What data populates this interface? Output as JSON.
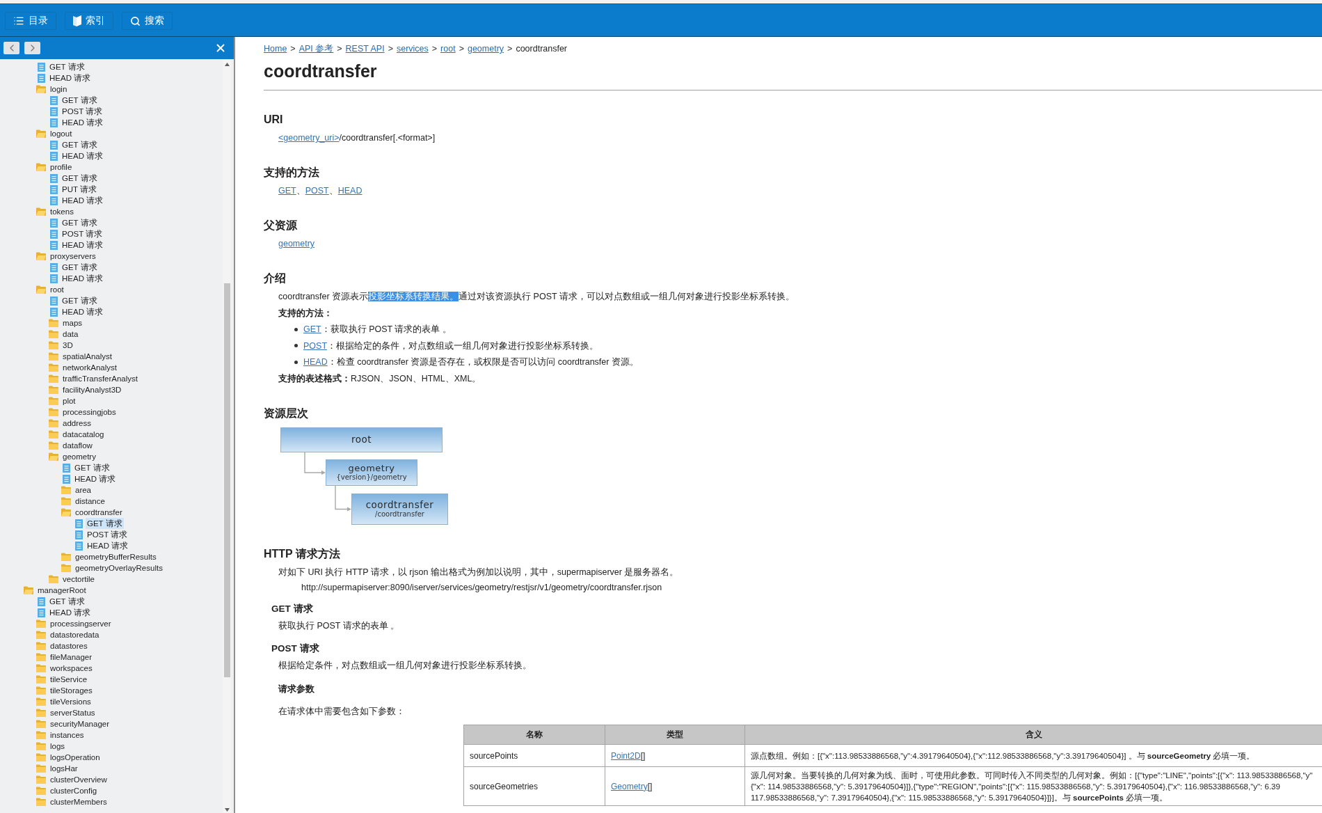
{
  "toolbar": {
    "buttons": [
      {
        "kind": "contents",
        "label": "目录"
      },
      {
        "kind": "index",
        "label": "索引"
      },
      {
        "kind": "search",
        "label": "搜索"
      }
    ]
  },
  "sidebar": {
    "tree": [
      {
        "children": [
          {
            "kind": "file",
            "label": "GET 请求",
            "selected": false
          },
          {
            "kind": "file",
            "label": "HEAD 请求",
            "selected": false
          },
          {
            "kind": "folder",
            "label": "login",
            "expanded": true,
            "selected": false,
            "children": [
              {
                "kind": "file",
                "label": "GET 请求",
                "selected": false
              },
              {
                "kind": "file",
                "label": "POST 请求",
                "selected": false
              },
              {
                "kind": "file",
                "label": "HEAD 请求",
                "selected": false
              }
            ]
          },
          {
            "kind": "folder",
            "label": "logout",
            "expanded": true,
            "selected": false,
            "children": [
              {
                "kind": "file",
                "label": "GET 请求",
                "selected": false
              },
              {
                "kind": "file",
                "label": "HEAD 请求",
                "selected": false
              }
            ]
          },
          {
            "kind": "folder",
            "label": "profile",
            "expanded": true,
            "selected": false,
            "children": [
              {
                "kind": "file",
                "label": "GET 请求",
                "selected": false
              },
              {
                "kind": "file",
                "label": "PUT 请求",
                "selected": false
              },
              {
                "kind": "file",
                "label": "HEAD 请求",
                "selected": false
              }
            ]
          },
          {
            "kind": "folder",
            "label": "tokens",
            "expanded": true,
            "selected": false,
            "children": [
              {
                "kind": "file",
                "label": "GET 请求",
                "selected": false
              },
              {
                "kind": "file",
                "label": "POST 请求",
                "selected": false
              },
              {
                "kind": "file",
                "label": "HEAD 请求",
                "selected": false
              }
            ]
          },
          {
            "kind": "folder",
            "label": "proxyservers",
            "expanded": true,
            "selected": false,
            "children": [
              {
                "kind": "file",
                "label": "GET 请求",
                "selected": false
              },
              {
                "kind": "file",
                "label": "HEAD 请求",
                "selected": false
              }
            ]
          },
          {
            "kind": "folder",
            "label": "root",
            "expanded": true,
            "selected": false,
            "children": [
              {
                "kind": "file",
                "label": "GET 请求",
                "selected": false
              },
              {
                "kind": "file",
                "label": "HEAD 请求",
                "selected": false
              },
              {
                "kind": "folder",
                "label": "maps",
                "expanded": false,
                "selected": false
              },
              {
                "kind": "folder",
                "label": "data",
                "expanded": false,
                "selected": false
              },
              {
                "kind": "folder",
                "label": "3D",
                "expanded": false,
                "selected": false
              },
              {
                "kind": "folder",
                "label": "spatialAnalyst",
                "expanded": false,
                "selected": false
              },
              {
                "kind": "folder",
                "label": "networkAnalyst",
                "expanded": false,
                "selected": false
              },
              {
                "kind": "folder",
                "label": "trafficTransferAnalyst",
                "expanded": false,
                "selected": false
              },
              {
                "kind": "folder",
                "label": "facilityAnalyst3D",
                "expanded": false,
                "selected": false
              },
              {
                "kind": "folder",
                "label": "plot",
                "expanded": false,
                "selected": false
              },
              {
                "kind": "folder",
                "label": "processingjobs",
                "expanded": false,
                "selected": false
              },
              {
                "kind": "folder",
                "label": "address",
                "expanded": false,
                "selected": false
              },
              {
                "kind": "folder",
                "label": "datacatalog",
                "expanded": false,
                "selected": false
              },
              {
                "kind": "folder",
                "label": "dataflow",
                "expanded": false,
                "selected": false
              },
              {
                "kind": "folder",
                "label": "geometry",
                "expanded": true,
                "selected": false,
                "children": [
                  {
                    "kind": "file",
                    "label": "GET 请求",
                    "selected": false
                  },
                  {
                    "kind": "file",
                    "label": "HEAD 请求",
                    "selected": false
                  },
                  {
                    "kind": "folder",
                    "label": "area",
                    "expanded": false,
                    "selected": false
                  },
                  {
                    "kind": "folder",
                    "label": "distance",
                    "expanded": false,
                    "selected": false
                  },
                  {
                    "kind": "folder",
                    "label": "coordtransfer",
                    "expanded": true,
                    "selected": false,
                    "children": [
                      {
                        "kind": "file",
                        "label": "GET 请求",
                        "selected": true
                      },
                      {
                        "kind": "file",
                        "label": "POST 请求",
                        "selected": false
                      },
                      {
                        "kind": "file",
                        "label": "HEAD 请求",
                        "selected": false
                      }
                    ]
                  },
                  {
                    "kind": "folder",
                    "label": "geometryBufferResults",
                    "expanded": false,
                    "selected": false
                  },
                  {
                    "kind": "folder",
                    "label": "geometryOverlayResults",
                    "expanded": false,
                    "selected": false
                  }
                ]
              },
              {
                "kind": "folder",
                "label": "vectortile",
                "expanded": false,
                "selected": false
              }
            ]
          }
        ]
      },
      {
        "kind": "folder",
        "label": "managerRoot",
        "expanded": true,
        "selected": false,
        "children": [
          {
            "kind": "file",
            "label": "GET 请求",
            "selected": false
          },
          {
            "kind": "file",
            "label": "HEAD 请求",
            "selected": false
          },
          {
            "kind": "folder",
            "label": "processingserver",
            "expanded": false,
            "selected": false
          },
          {
            "kind": "folder",
            "label": "datastoredata",
            "expanded": false,
            "selected": false
          },
          {
            "kind": "folder",
            "label": "datastores",
            "expanded": false,
            "selected": false
          },
          {
            "kind": "folder",
            "label": "fileManager",
            "expanded": false,
            "selected": false
          },
          {
            "kind": "folder",
            "label": "workspaces",
            "expanded": false,
            "selected": false
          },
          {
            "kind": "folder",
            "label": "tileService",
            "expanded": false,
            "selected": false
          },
          {
            "kind": "folder",
            "label": "tileStorages",
            "expanded": false,
            "selected": false
          },
          {
            "kind": "folder",
            "label": "tileVersions",
            "expanded": false,
            "selected": false
          },
          {
            "kind": "folder",
            "label": "serverStatus",
            "expanded": false,
            "selected": false
          },
          {
            "kind": "folder",
            "label": "securityManager",
            "expanded": false,
            "selected": false
          },
          {
            "kind": "folder",
            "label": "instances",
            "expanded": false,
            "selected": false
          },
          {
            "kind": "folder",
            "label": "logs",
            "expanded": false,
            "selected": false
          },
          {
            "kind": "folder",
            "label": "logsOperation",
            "expanded": false,
            "selected": false
          },
          {
            "kind": "folder",
            "label": "logsHar",
            "expanded": false,
            "selected": false
          },
          {
            "kind": "folder",
            "label": "clusterOverview",
            "expanded": false,
            "selected": false
          },
          {
            "kind": "folder",
            "label": "clusterConfig",
            "expanded": false,
            "selected": false
          },
          {
            "kind": "folder",
            "label": "clusterMembers",
            "expanded": false,
            "selected": false
          }
        ]
      }
    ]
  },
  "breadcrumb": {
    "separator": ">",
    "items": [
      {
        "label": "Home",
        "link": true
      },
      {
        "label": "API 参考",
        "link": true
      },
      {
        "label": "REST API",
        "link": true
      },
      {
        "label": "services",
        "link": true
      },
      {
        "label": "root",
        "link": true
      },
      {
        "label": "geometry",
        "link": true
      },
      {
        "label": "coordtransfer",
        "link": false
      }
    ]
  },
  "title": "coordtransfer",
  "uri": {
    "heading": "URI",
    "link": "<geometry_uri>",
    "path": "/coordtransfer[.<format>]"
  },
  "methods": {
    "heading": "支持的方法",
    "separator": "、",
    "links": [
      "GET",
      "POST",
      "HEAD"
    ]
  },
  "parent": {
    "heading": "父资源",
    "link": "geometry"
  },
  "intro": {
    "heading": "介绍",
    "segments": [
      {
        "text": "coordtransfer 资源表示",
        "highlighted": false
      },
      {
        "text": "投影坐标系转换结果。",
        "highlighted": true
      },
      {
        "text": "通过对该资源执行 POST 请求，可以对点数组或一组几何对象进行投影坐标系转换。",
        "highlighted": false
      }
    ],
    "methods_label": "支持的方法：",
    "methods": [
      {
        "link": "GET",
        "text": "：获取执行 POST 请求的表单 。"
      },
      {
        "link": "POST",
        "text": "：根据给定的条件，对点数组或一组几何对象进行投影坐标系转换。"
      },
      {
        "link": "HEAD",
        "text": "：检查 coordtransfer 资源是否存在，或权限是否可以访问 coordtransfer 资源。"
      }
    ],
    "formats": "**支持的表述格式：**RJSON、JSON、HTML、XML。"
  },
  "hierarchy": {
    "heading": "资源层次",
    "nodes": [
      {
        "title": "root"
      },
      {
        "title": "geometry",
        "path": "{version}/geometry"
      },
      {
        "title": "coordtransfer",
        "path": "/coordtransfer"
      }
    ]
  },
  "http": {
    "heading": "HTTP 请求方法",
    "text": "对如下 URI 执行 HTTP 请求，以 rjson 输出格式为例加以说明，其中，supermapiserver 是服务器名。",
    "url": "http://supermapiserver:8090/iserver/services/geometry/restjsr/v1/geometry/coordtransfer.rjson",
    "requests": [
      {
        "heading": "GET 请求",
        "text": "获取执行 POST 请求的表单 。"
      },
      {
        "heading": "POST 请求",
        "text": "根据给定条件，对点数组或一组几何对象进行投影坐标系转换。",
        "params_heading": "请求参数",
        "params_text": "在请求体中需要包含如下参数："
      }
    ]
  },
  "table": {
    "columns": [
      "名称",
      "类型",
      "含义"
    ],
    "rows": [
      {
        "name": "sourcePoints",
        "type_link": "Point2D",
        "type_suffix": "[]",
        "description": [
          "源点数组。例如：[{\"x\":113.98533886568,\"y\":4.39179640504},{\"x\":112.98533886568,\"y\":3.39179640504}] 。与 **sourceGeometry** 必填一项。"
        ]
      },
      {
        "name": "sourceGeometries",
        "type_link": "Geometry",
        "type_suffix": "[]",
        "description": [
          "源几何对象。当要转换的几何对象为线、面时，可使用此参数。可同时传入不同类型的几何对象。例如：[{\"type\":\"LINE\",\"points\":[{\"x\": 113.98533886568,\"y\"",
          "{\"x\": 114.98533886568,\"y\": 5.39179640504}]},{\"type\":\"REGION\",\"points\":[{\"x\": 115.98533886568,\"y\": 5.39179640504},{\"x\": 116.98533886568,\"y\": 6.39",
          "117.98533886568,\"y\": 7.39179640504},{\"x\": 115.98533886568,\"y\": 5.39179640504}]}]。与 **sourcePoints** 必填一项。"
        ]
      }
    ]
  }
}
